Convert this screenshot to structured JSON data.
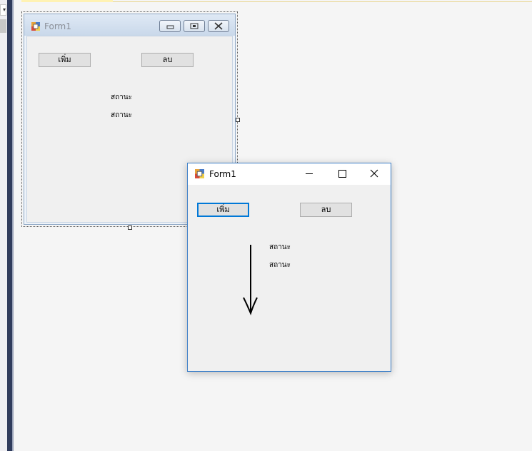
{
  "designer_form": {
    "title": "Form1",
    "buttons": {
      "add": "เพิ่ม",
      "delete": "ลบ"
    },
    "labels": [
      "สถานะ",
      "สถานะ"
    ]
  },
  "runtime_form": {
    "title": "Form1",
    "caption_buttons": {
      "minimize": "—",
      "maximize": "☐",
      "close": "✕"
    },
    "buttons": {
      "add": "เพิ่ม",
      "delete": "ลบ"
    },
    "labels": [
      "สถานะ",
      "สถานะ"
    ]
  },
  "annotation": {
    "arrow_icon": "arrow-down-icon"
  }
}
